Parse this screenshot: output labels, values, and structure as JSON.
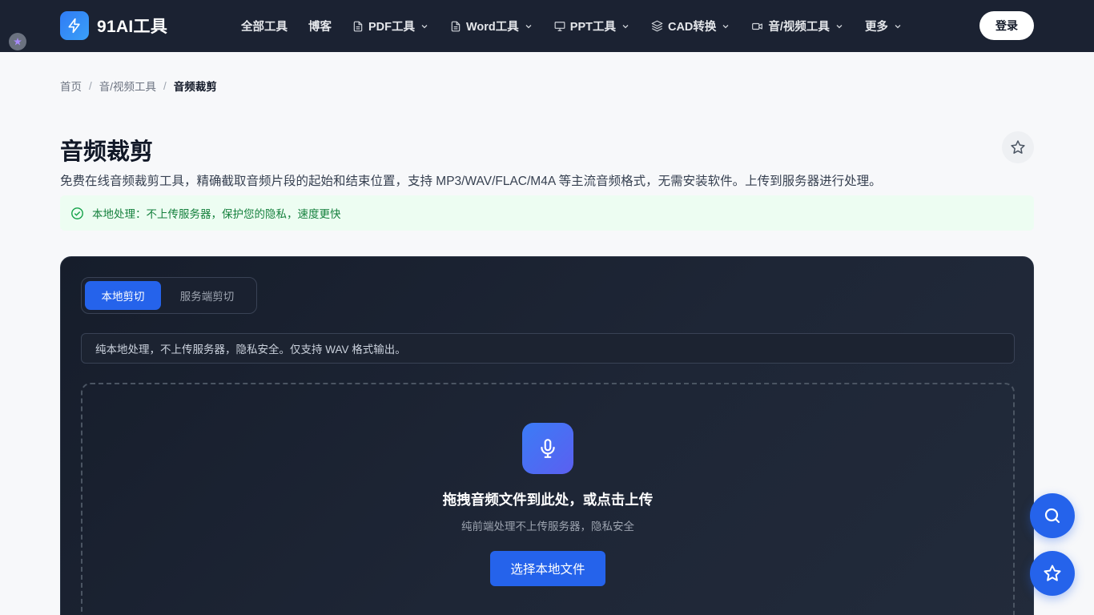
{
  "header": {
    "logo_text": "91AI工具",
    "nav": [
      {
        "label": "全部工具",
        "icon": "",
        "dropdown": false
      },
      {
        "label": "博客",
        "icon": "",
        "dropdown": false
      },
      {
        "label": "PDF工具",
        "icon": "file-icon",
        "dropdown": true
      },
      {
        "label": "Word工具",
        "icon": "file-icon",
        "dropdown": true
      },
      {
        "label": "PPT工具",
        "icon": "presentation-icon",
        "dropdown": true
      },
      {
        "label": "CAD转换",
        "icon": "layers-icon",
        "dropdown": true
      },
      {
        "label": "音/视频工具",
        "icon": "video-icon",
        "dropdown": true
      },
      {
        "label": "更多",
        "icon": "",
        "dropdown": true
      }
    ],
    "login_label": "登录"
  },
  "breadcrumb": {
    "home": "首页",
    "category": "音/视频工具",
    "current": "音频裁剪",
    "separator": "/"
  },
  "page": {
    "title": "音频裁剪",
    "description": "免费在线音频裁剪工具，精确截取音频片段的起始和结束位置，支持 MP3/WAV/FLAC/M4A 等主流音频格式，无需安装软件。上传到服务器进行处理。",
    "notice": "本地处理：不上传服务器，保护您的隐私，速度更快"
  },
  "tool": {
    "tabs": [
      {
        "label": "本地剪切",
        "active": true
      },
      {
        "label": "服务端剪切",
        "active": false
      }
    ],
    "info": "纯本地处理，不上传服务器，隐私安全。仅支持 WAV 格式输出。",
    "drop_title": "拖拽音频文件到此处，或点击上传",
    "drop_subtitle": "纯前端处理不上传服务器，隐私安全",
    "choose_button": "选择本地文件"
  },
  "colors": {
    "header_bg": "#1b2232",
    "accent": "#2563eb",
    "notice_bg": "#edfdf2",
    "notice_text": "#15803d",
    "panel_bg": "#1e2636"
  }
}
